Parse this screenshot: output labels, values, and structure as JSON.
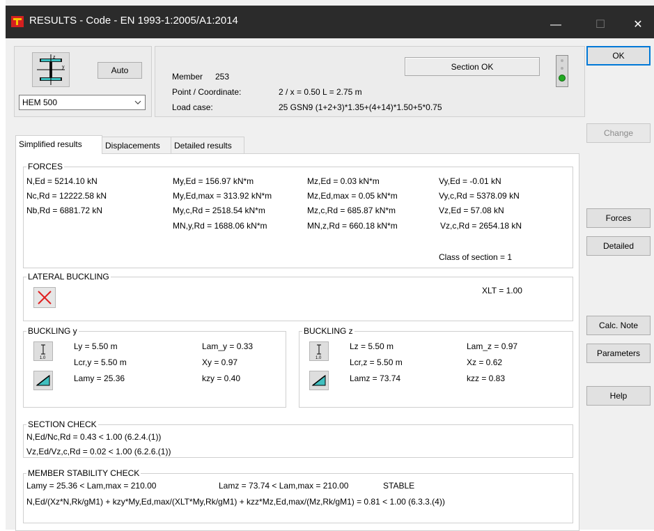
{
  "window": {
    "title": "RESULTS - Code - EN 1993-1:2005/A1:2014",
    "minimize": "—",
    "maximize": "☐",
    "close": "✕"
  },
  "section_panel": {
    "auto_label": "Auto",
    "profile": "HEM 500"
  },
  "info": {
    "member_label": "Member",
    "member_value": "253",
    "point_label": "Point / Coordinate:",
    "point_value": "2 / x = 0.50 L = 2.75 m",
    "loadcase_label": "Load case:",
    "loadcase_value": "25 GSN9  (1+2+3)*1.35+(4+14)*1.50+5*0.75",
    "status": "Section OK",
    "status_color": "#22aa22"
  },
  "tabs": [
    "Simplified results",
    "Displacements",
    "Detailed results"
  ],
  "right_buttons": {
    "ok": "OK",
    "change": "Change",
    "forces": "Forces",
    "detailed": "Detailed",
    "calc_note": "Calc. Note",
    "parameters": "Parameters",
    "help": "Help"
  },
  "forces": {
    "title": "FORCES",
    "col1": [
      "N,Ed = 5214.10 kN",
      "Nc,Rd = 12222.58 kN",
      "Nb,Rd = 6881.72 kN"
    ],
    "col2": [
      "My,Ed = 156.97 kN*m",
      "My,Ed,max = 313.92 kN*m",
      "My,c,Rd = 2518.54 kN*m",
      "MN,y,Rd = 1688.06 kN*m"
    ],
    "col3": [
      "Mz,Ed = 0.03 kN*m",
      "Mz,Ed,max = 0.05 kN*m",
      "Mz,c,Rd = 685.87 kN*m",
      "MN,z,Rd = 660.18 kN*m"
    ],
    "col4": [
      "Vy,Ed = -0.01 kN",
      "Vy,c,Rd = 5378.09 kN",
      "Vz,Ed = 57.08 kN",
      "Vz,c,Rd = 2654.18 kN"
    ],
    "class": "Class of section = 1"
  },
  "lateral": {
    "title": "LATERAL BUCKLING",
    "xlt": "XLT = 1.00"
  },
  "buckling_y": {
    "title": "BUCKLING y",
    "l1": "Ly = 5.50 m",
    "l2": "Lcr,y = 5.50 m",
    "l3": "Lamy = 25.36",
    "r1": "Lam_y = 0.33",
    "r2": "Xy = 0.97",
    "r3": "kzy = 0.40",
    "icon_num": "1.0"
  },
  "buckling_z": {
    "title": "BUCKLING z",
    "l1": "Lz = 5.50 m",
    "l2": "Lcr,z = 5.50 m",
    "l3": "Lamz = 73.74",
    "r1": "Lam_z = 0.97",
    "r2": "Xz = 0.62",
    "r3": "kzz = 0.83",
    "icon_num": "1.0"
  },
  "section_check": {
    "title": "SECTION CHECK",
    "line1": "N,Ed/Nc,Rd = 0.43 < 1.00   (6.2.4.(1))",
    "line2": "Vz,Ed/Vz,c,Rd = 0.02 < 1.00   (6.2.6.(1))"
  },
  "stability": {
    "title": "MEMBER STABILITY CHECK",
    "line1a": "Lamy = 25.36 < Lam,max = 210.00",
    "line1b": "Lamz = 73.74 < Lam,max = 210.00",
    "line1c": "STABLE",
    "line2": "N,Ed/(Xz*N,Rk/gM1) + kzy*My,Ed,max/(XLT*My,Rk/gM1) + kzz*Mz,Ed,max/(Mz,Rk/gM1) = 0.81 < 1.00   (6.3.3.(4))"
  }
}
